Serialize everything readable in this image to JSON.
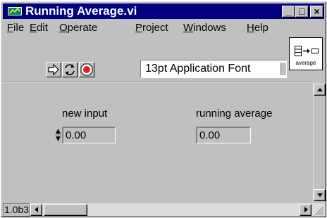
{
  "window": {
    "title": "Running Average.vi",
    "controls": {
      "minimize": "_",
      "maximize": "□",
      "close": "×"
    }
  },
  "menubar": {
    "items": [
      {
        "mnemonic": "F",
        "rest": "ile"
      },
      {
        "mnemonic": "E",
        "rest": "dit"
      },
      {
        "mnemonic": "O",
        "rest": "perate"
      },
      {
        "mnemonic": "P",
        "rest": "roject"
      },
      {
        "mnemonic": "W",
        "rest": "indows"
      },
      {
        "mnemonic": "H",
        "rest": "elp"
      }
    ]
  },
  "toolbar": {
    "run_icon": "run-arrow-icon",
    "run_continuous_icon": "run-continuously-icon",
    "abort_icon": "abort-stop-icon",
    "font_ring": "13pt Application Font"
  },
  "vi_icon": {
    "label": "average",
    "glyph": "array-to-scalar-icon"
  },
  "front_panel": {
    "control": {
      "label": "new input",
      "value": "0.00"
    },
    "indicator": {
      "label": "running average",
      "value": "0.00"
    }
  },
  "status": {
    "version": "1.0b3"
  },
  "colors": {
    "titlebar": "#000080",
    "face": "#c0c0c0",
    "abort_red": "#e02020"
  }
}
